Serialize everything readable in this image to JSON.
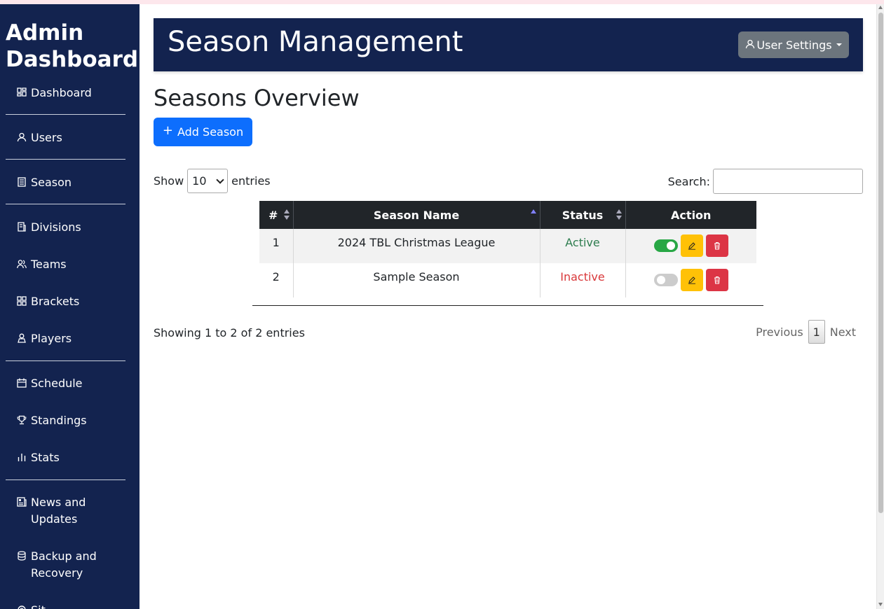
{
  "sidebar": {
    "brand": "Admin Dashboard",
    "items": [
      {
        "label": "Dashboard",
        "icon": "dashboard-icon"
      },
      {
        "label": "Users",
        "icon": "user-icon"
      },
      {
        "label": "Season",
        "icon": "document-icon"
      },
      {
        "label": "Divisions",
        "icon": "document-list-icon"
      },
      {
        "label": "Teams",
        "icon": "people-icon"
      },
      {
        "label": "Brackets",
        "icon": "grid-icon"
      },
      {
        "label": "Players",
        "icon": "player-icon"
      },
      {
        "label": "Schedule",
        "icon": "calendar-icon"
      },
      {
        "label": "Standings",
        "icon": "trophy-icon"
      },
      {
        "label": "Stats",
        "icon": "bar-chart-icon"
      },
      {
        "label": "News and Updates",
        "icon": "newspaper-icon"
      },
      {
        "label": "Backup and Recovery",
        "icon": "database-icon"
      },
      {
        "label": "Sit",
        "icon": "settings-icon"
      }
    ]
  },
  "header": {
    "title": "Season Management",
    "user_settings_label": "User Settings"
  },
  "main": {
    "title": "Seasons Overview",
    "add_button_label": "Add Season",
    "show_label": "Show",
    "entries_label": "entries",
    "page_length": "10",
    "search_label": "Search:",
    "search_value": ""
  },
  "table": {
    "columns": [
      "#",
      "Season Name",
      "Status",
      "Action"
    ],
    "rows": [
      {
        "num": "1",
        "name": "2024 TBL Christmas League",
        "status": "Active",
        "enabled": true
      },
      {
        "num": "2",
        "name": "Sample Season",
        "status": "Inactive",
        "enabled": false
      }
    ],
    "info": "Showing 1 to 2 of 2 entries",
    "previous": "Previous",
    "current_page": "1",
    "next": "Next"
  },
  "colors": {
    "sidebar_bg": "#13234f",
    "primary": "#0d6efd",
    "active": "#2e7d4f",
    "inactive": "#d9383a",
    "edit": "#ffc107",
    "delete": "#dc3545"
  }
}
